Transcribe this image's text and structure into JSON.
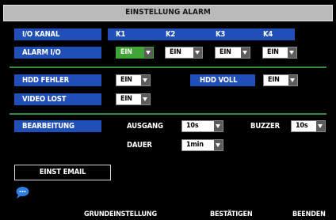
{
  "title": "EINSTELLUNG ALARM",
  "io_kanal": {
    "label": "I/O KANAL",
    "channels": [
      "K1",
      "K2",
      "K3",
      "K4"
    ]
  },
  "alarm_io": {
    "label": "ALARM I/O",
    "values": [
      "EIN",
      "EIN",
      "EIN",
      "EIN"
    ]
  },
  "hdd_fehler": {
    "label": "HDD FEHLER",
    "value": "EIN"
  },
  "hdd_voll": {
    "label": "HDD VOLL",
    "value": "EIN"
  },
  "video_lost": {
    "label": "VIDEO LOST",
    "value": "EIN"
  },
  "bearbeitung": {
    "label": "BEARBEITUNG",
    "ausgang_label": "AUSGANG",
    "ausgang_value": "10s",
    "buzzer_label": "BUZZER",
    "buzzer_value": "10s",
    "dauer_label": "DAUER",
    "dauer_value": "1min"
  },
  "email_button": "EINST EMAIL",
  "bottom_bar": {
    "grundeinstellung": "GRUNDEINSTELLUNG",
    "bestaetigen": "BESTÄTIGEN",
    "beenden": "BEENDEN"
  },
  "colors": {
    "label_bg": "#1f4fb7",
    "selected_bg": "#3fa535",
    "separator": "#2f8a3a",
    "title_bg": "#b9b9b9"
  }
}
